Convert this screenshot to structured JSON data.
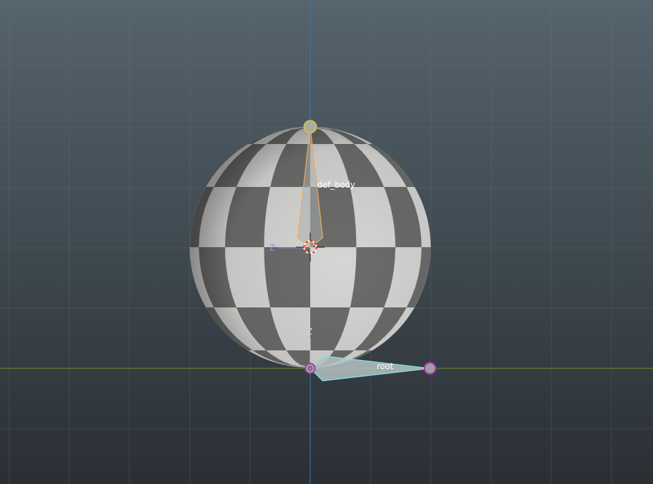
{
  "viewport": {
    "view": "3d-viewport",
    "colors": {
      "background_top": "#56646d",
      "background_bottom": "#2a2f34",
      "grid_line": "#5a666f",
      "axis_vertical": "#3a78b8",
      "axis_horizontal": "#6e8e2a",
      "mesh_light": "#d2d2d0",
      "mesh_dark": "#6a6a68",
      "bone_selected_outline": "#f0a860",
      "bone_active_outline": "#7fe8e0",
      "bone_fill": "#a9b1b2",
      "joint_highlight": "#e0c040",
      "joint_magenta": "#c030b0"
    }
  },
  "bones": [
    {
      "name": "def_body",
      "state": "selected"
    },
    {
      "name": "root",
      "state": "active"
    }
  ],
  "gizmo": {
    "z_label": "Z",
    "z_neg_label": "Z⁻"
  }
}
